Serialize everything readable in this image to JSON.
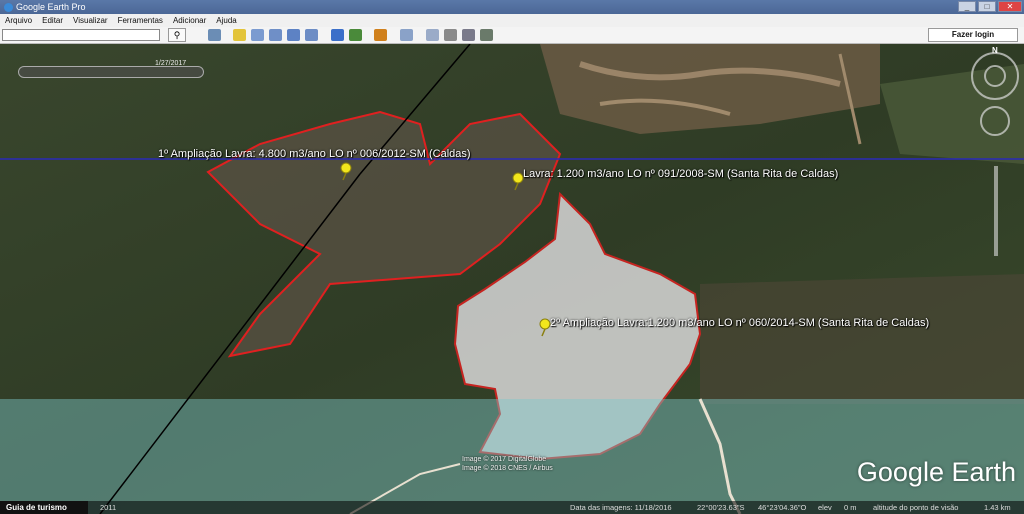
{
  "window": {
    "title": "Google Earth Pro",
    "minimize": "_",
    "maximize": "□",
    "close": "✕"
  },
  "menu": [
    "Arquivo",
    "Editar",
    "Visualizar",
    "Ferramentas",
    "Adicionar",
    "Ajuda"
  ],
  "toolbar": {
    "search_value": "",
    "search_icon": "search-icon",
    "login_label": "Fazer login",
    "icons": [
      "sidebar-icon",
      "placemark-icon",
      "polygon-icon",
      "path-icon",
      "overlay-icon",
      "tour-icon",
      "historical-imagery-icon",
      "sun-icon",
      "planets-icon",
      "ruler-icon",
      "email-icon",
      "print-icon",
      "save-image-icon",
      "maps-icon"
    ]
  },
  "map": {
    "time_slider_date": "1/27/2017",
    "placemarks": [
      {
        "label": "1º Ampliação Lavra: 4.800 m3/ano LO nº 006/2012-SM (Caldas)"
      },
      {
        "label": "Lavra: 1.200 m3/ano LO nº 091/2008-SM (Santa Rita de Caldas)"
      },
      {
        "label": "2º Ampliação Lavra:1.200 m3/ano LO nº 060/2014-SM (Santa Rita de Caldas)"
      }
    ],
    "copyright_1": "Image © 2017 DigitalGlobe",
    "copyright_2": "Image © 2018 CNES / Airbus",
    "logo": "Google Earth",
    "compass_north": "N",
    "colors": {
      "polygon_outline": "#e02020",
      "guide_line": "#2a2ab8",
      "pin": "#f2e61c"
    }
  },
  "status": {
    "tour_button": "Guia de turismo",
    "year": "2011",
    "imagery_date": "Data das imagens: 11/18/2016",
    "lat": "22°00'23.63\"S",
    "lon": "46°23'04.36\"O",
    "elev": "elev",
    "elev_value": "0 m",
    "eye_alt": "altitude do ponto de visão",
    "eye_alt_value": "1.43 km"
  }
}
